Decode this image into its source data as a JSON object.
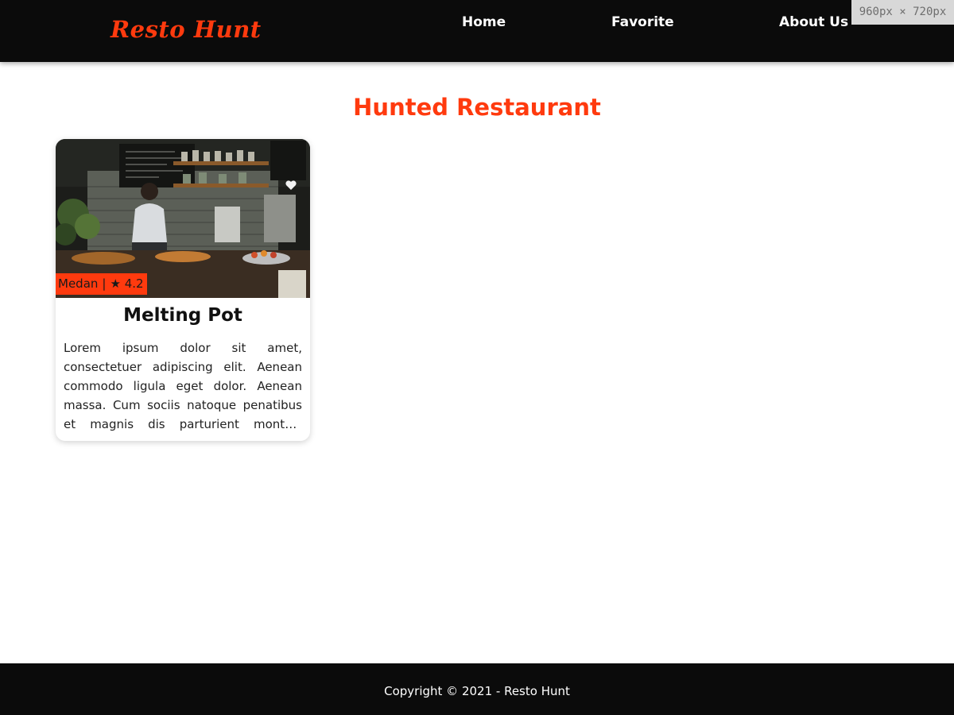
{
  "header": {
    "logo": "Resto Hunt",
    "nav": {
      "home": "Home",
      "favorite": "Favorite",
      "about": "About Us"
    }
  },
  "viewport_overlay": "960px × 720px",
  "main": {
    "title": "Hunted Restaurant",
    "restaurants": [
      {
        "name": "Melting Pot",
        "city": "Medan",
        "separator": "|",
        "rating": "4.2",
        "rating_icon": "star-icon",
        "description": "Lorem ipsum dolor sit amet, consectetuer adipiscing elit. Aenean commodo ligula eget dolor. Aenean massa. Cum sociis natoque penatibus et magnis dis parturient montes, nascetur ridiculus mus."
      }
    ]
  },
  "footer": {
    "text": "Copyright © 2021 - Resto Hunt"
  },
  "colors": {
    "accent": "#ff3a0e",
    "header_bg": "#0b0b0b",
    "footer_bg": "#0b0b0b",
    "text": "#111111"
  }
}
